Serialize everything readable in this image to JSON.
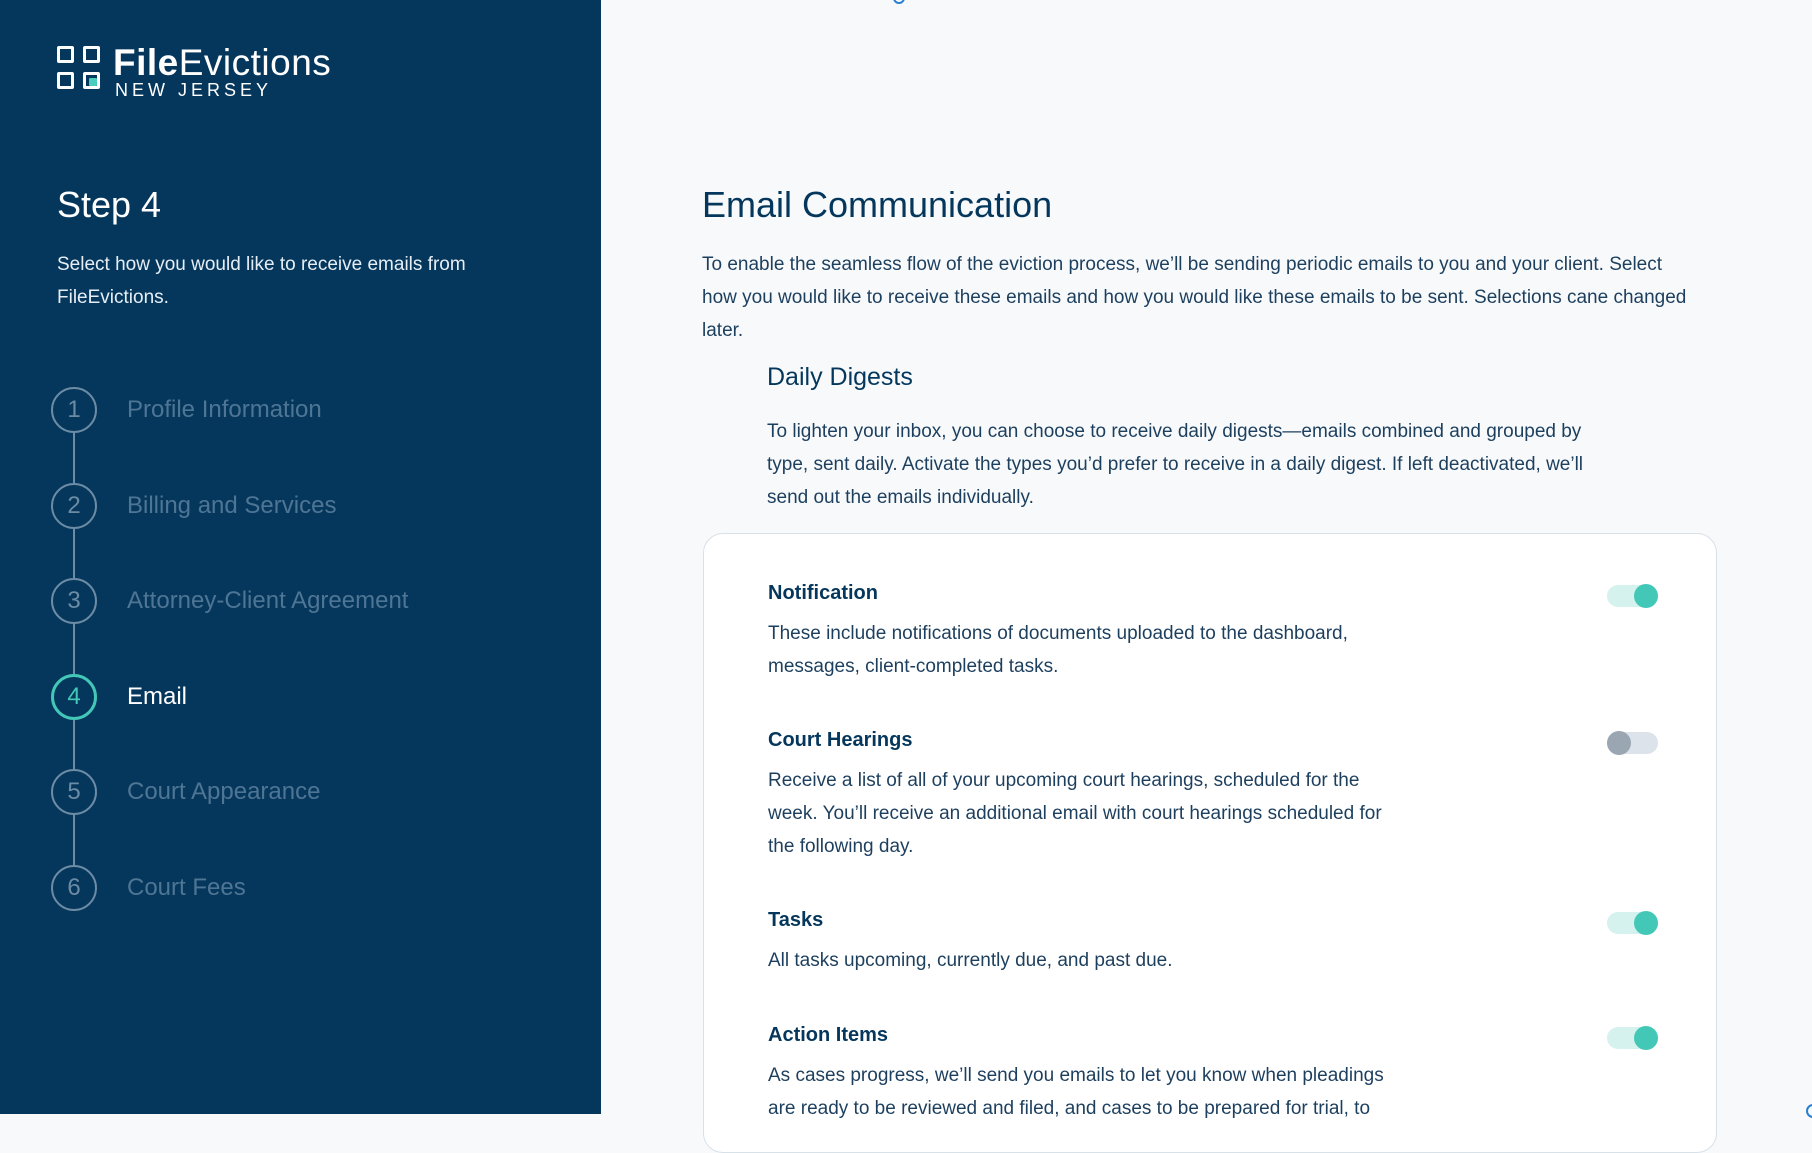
{
  "brand": {
    "name_bold": "File",
    "name_regular": "Evictions",
    "region": "NEW JERSEY"
  },
  "sidebar": {
    "step_title": "Step 4",
    "step_description": "Select how you would like to receive emails from FileEvictions.",
    "steps": [
      {
        "number": "1",
        "label": "Profile Information",
        "active": false
      },
      {
        "number": "2",
        "label": "Billing and Services",
        "active": false
      },
      {
        "number": "3",
        "label": "Attorney-Client Agreement",
        "active": false
      },
      {
        "number": "4",
        "label": "Email",
        "active": true
      },
      {
        "number": "5",
        "label": "Court Appearance",
        "active": false
      },
      {
        "number": "6",
        "label": "Court Fees",
        "active": false
      }
    ]
  },
  "main": {
    "title": "Email Communication",
    "intro": "To enable the seamless flow of the eviction process, we’ll be sending periodic emails to you and your client. Select how you would like to receive these emails and how you would like these emails to be sent. Selections cane changed later.",
    "digest_title": "Daily Digests",
    "digest_description": "To lighten your inbox, you can choose to receive daily digests—emails combined and grouped by type, sent daily. Activate the types you’d prefer to receive in a daily digest. If left deactivated, we’ll send out the emails individually.",
    "options": [
      {
        "title": "Notification",
        "description": "These include notifications of documents uploaded to the dashboard, messages, client-completed tasks.",
        "enabled": true
      },
      {
        "title": "Court Hearings",
        "description": "Receive a list of all of your upcoming court hearings, scheduled for the week. You’ll receive an additional email with court hearings scheduled for the following day.",
        "enabled": false
      },
      {
        "title": "Tasks",
        "description": "All tasks upcoming, currently due, and past due.",
        "enabled": true
      },
      {
        "title": "Action Items",
        "description": "As cases progress, we’ll send you emails to let you know when pleadings are ready to be reviewed and filed, and cases to be prepared for trial, to",
        "enabled": true
      }
    ]
  },
  "colors": {
    "sidebar_bg": "#05375c",
    "accent": "#43c8b8",
    "text_dark": "#05375c"
  }
}
